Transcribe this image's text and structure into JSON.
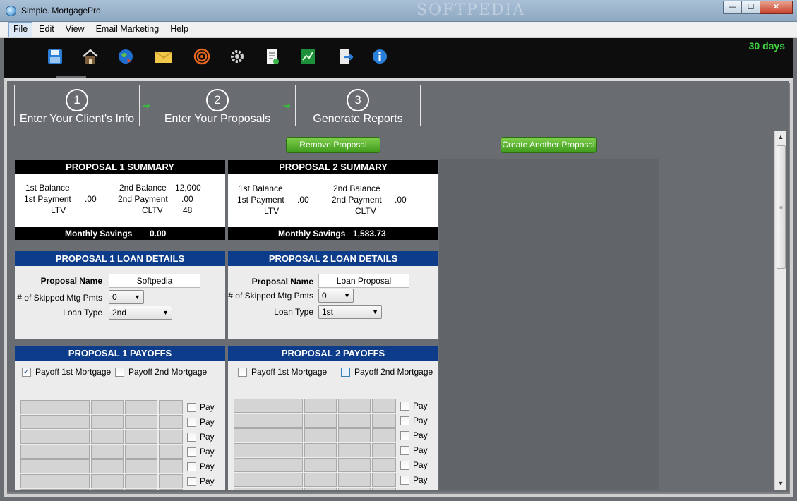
{
  "window": {
    "title": "Simple. MortgagePro",
    "watermark": "SOFTPEDIA",
    "btn_min": "—",
    "btn_max": "☐",
    "btn_close": "✕"
  },
  "menu": {
    "items": [
      "File",
      "Edit",
      "View",
      "Email Marketing",
      "Help"
    ],
    "active_index": 0
  },
  "toolbar": {
    "trial_text": "30 days",
    "icons": [
      "save-icon",
      "house-icon",
      "globe-icon",
      "envelope-icon",
      "target-icon",
      "gear-icon",
      "report-icon",
      "chart-icon",
      "export-icon",
      "info-icon"
    ]
  },
  "steps": [
    {
      "number": "1",
      "label": "Enter Your Client's Info"
    },
    {
      "number": "2",
      "label": "Enter Your Proposals"
    },
    {
      "number": "3",
      "label": "Generate Reports"
    }
  ],
  "actions": {
    "remove_label": "Remove Proposal",
    "create_label": "Create Another Proposal"
  },
  "proposals": [
    {
      "summary_title": "PROPOSAL 1 SUMMARY",
      "first_balance_label": "1st Balance",
      "first_balance_value": "",
      "second_balance_label": "2nd Balance",
      "second_balance_value": "12,000",
      "first_payment_label": "1st Payment",
      "first_payment_value": ".00",
      "second_payment_label": "2nd Payment",
      "second_payment_value": ".00",
      "ltv_label": "LTV",
      "ltv_value": "",
      "cltv_label": "CLTV",
      "cltv_value": "48",
      "savings_label": "Monthly Savings",
      "savings_value": "0.00",
      "details_title": "PROPOSAL 1 LOAN DETAILS",
      "name_label": "Proposal Name",
      "name_value": "Softpedia",
      "skipped_label": "# of Skipped Mtg Pmts",
      "skipped_value": "0",
      "loan_type_label": "Loan Type",
      "loan_type_value": "2nd",
      "payoffs_title": "PROPOSAL 1 PAYOFFS",
      "payoff1_label": "Payoff 1st Mortgage",
      "payoff1_checked": "✓",
      "payoff2_label": "Payoff 2nd Mortgage",
      "payoff2_checked": ""
    },
    {
      "summary_title": "PROPOSAL 2 SUMMARY",
      "first_balance_label": "1st Balance",
      "first_balance_value": "",
      "second_balance_label": "2nd Balance",
      "second_balance_value": "",
      "first_payment_label": "1st Payment",
      "first_payment_value": ".00",
      "second_payment_label": "2nd Payment",
      "second_payment_value": ".00",
      "ltv_label": "LTV",
      "ltv_value": "",
      "cltv_label": "CLTV",
      "cltv_value": "",
      "savings_label": "Monthly Savings",
      "savings_value": "1,583.73",
      "details_title": "PROPOSAL 2 LOAN DETAILS",
      "name_label": "Proposal Name",
      "name_value": "Loan Proposal",
      "skipped_label": "# of Skipped Mtg Pmts",
      "skipped_value": "0",
      "loan_type_label": "Loan Type",
      "loan_type_value": "1st",
      "payoffs_title": "PROPOSAL 2 PAYOFFS",
      "payoff1_label": "Payoff 1st Mortgage",
      "payoff1_checked": "",
      "payoff2_label": "Payoff 2nd Mortgage",
      "payoff2_checked": ""
    }
  ],
  "payoff_row_label": "Pay",
  "scrollbar": {
    "up": "▲",
    "down": "▼",
    "grip": "≡"
  }
}
